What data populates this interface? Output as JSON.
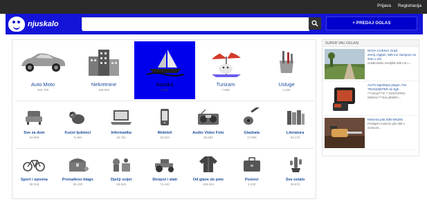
{
  "topbar": {
    "login_label": "Prijava",
    "register_label": "Registracija"
  },
  "header": {
    "logo_text": "njuskalo",
    "search": {
      "placeholder": "",
      "value": ""
    },
    "post_button_label": "+ PREDAJ OGLAS"
  },
  "categories": {
    "row1": [
      {
        "label": "Auto Moto",
        "count": "302.785",
        "icon": "car-icon"
      },
      {
        "label": "Nekretnine",
        "count": "168.003",
        "icon": "buildings-icon"
      },
      {
        "label": "Nautika",
        "count": "6.211",
        "icon": "sailboat-icon",
        "active": true
      },
      {
        "label": "Turizam",
        "count": "7.088",
        "icon": "beach-umbrella-icon"
      },
      {
        "label": "Usluge",
        "count": "4.330",
        "icon": "tools-icon"
      }
    ],
    "row2": [
      {
        "label": "Sve za dom",
        "count": "94.696",
        "icon": "armchair-icon"
      },
      {
        "label": "Kućni ljubimci",
        "count": "9.466",
        "icon": "dog-icon"
      },
      {
        "label": "Informatika",
        "count": "40.751",
        "icon": "laptop-icon"
      },
      {
        "label": "Mobiteli",
        "count": "43.023",
        "icon": "mobile-phone-icon"
      },
      {
        "label": "Audio Video Foto",
        "count": "30.693",
        "icon": "radio-icon"
      },
      {
        "label": "Glazbala",
        "count": "17.656",
        "icon": "guitar-icon"
      },
      {
        "label": "Literatura",
        "count": "62.173",
        "icon": "books-icon"
      }
    ],
    "row3": [
      {
        "label": "Sport i oprema",
        "count": "38.319",
        "icon": "bicycle-icon"
      },
      {
        "label": "Pronađeno blago",
        "count": "35.030",
        "icon": "treasure-chest-icon"
      },
      {
        "label": "Dječji svijet",
        "count": "58.526",
        "icon": "toys-icon"
      },
      {
        "label": "Strojevi i alati",
        "count": "73.440",
        "icon": "tractor-icon"
      },
      {
        "label": "Od glave do pete",
        "count": "105.404",
        "icon": "jacket-icon"
      },
      {
        "label": "Poslovi",
        "count": "1.430",
        "icon": "briefcase-icon"
      },
      {
        "label": "Sve ostalo",
        "count": "39.673",
        "icon": "cactus-icon"
      }
    ]
  },
  "aside": {
    "title": "SUPER VAU OGLASI",
    "ads": [
      {
        "title": "NOVA CIJENA! Građ. zemlj.,Ogljan, 585 m2 Samjene za stan u ZG",
        "desc": "Građevinsko zemljište 585 m2 u ..."
      },
      {
        "title": "AUTO Mp3/Mp4 player, FM TRANSMITER do 6gb",
        "desc": "***AirCar***!!! ** DOSTUPNO ODMAH ***SALJEMO!!!..."
      },
      {
        "title": "Motorna pila Stihl MS291",
        "desc": "Prodajem motornu pilu 380 u ovrsnom..."
      }
    ]
  },
  "colors": {
    "header_bg": "#1414d8",
    "topbar_bg": "#2a2a2a",
    "active_category_bg": "#0000ee",
    "link_color": "#1a4b9c"
  }
}
